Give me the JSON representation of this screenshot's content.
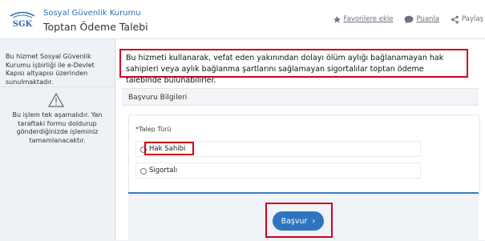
{
  "header": {
    "org_name": "Sosyal Güvenlik Kurumu",
    "title": "Toptan Ödeme Talebi",
    "logo_text": "SGK",
    "actions": [
      {
        "label": "Favorilere ekle",
        "icon": "star-icon"
      },
      {
        "label": "Puanla",
        "icon": "chat-bubble-icon"
      },
      {
        "label": "Paylaş",
        "icon": "share-icon"
      }
    ]
  },
  "sidebar": {
    "provider_text": "Bu hizmet Sosyal Güvenlik Kurumu işbirliği ile e-Devlet Kapısı altyapısı üzerinden sunulmaktadır.",
    "step_icon": "warning-triangle-icon",
    "step_text": "Bu işlem tek aşamalıdır. Yan taraftaki formu doldurup gönderdiğinizde işleminiz tamamlanacaktır."
  },
  "main": {
    "info_text": "Bu hizmeti kullanarak, vefat eden yakınından dolayı ölüm aylığı bağlanamayan hak sahipleri veya aylık bağlanma şartlarını sağlamayan sigortalılar toptan ödeme talebinde bulunabilirler.",
    "section_title": "Başvuru Bilgileri",
    "field_label": "*Talep Türü",
    "options": [
      "Hak Sahibi",
      "Sigortalı"
    ],
    "submit_label": "Başvur"
  },
  "colors": {
    "accent": "#2e75bf",
    "highlight": "#d0021b",
    "org_text": "#2d6fb4"
  }
}
